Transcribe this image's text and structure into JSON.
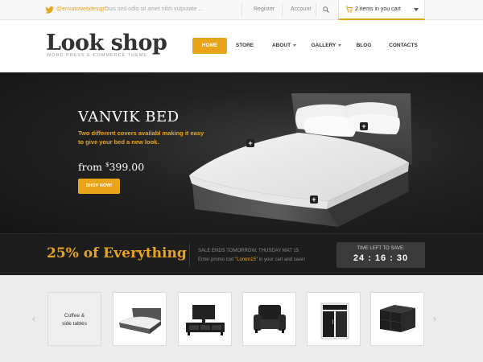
{
  "topbar": {
    "twitter_handle": "@envatowebdesign:",
    "tweet": "Duis sed odio sit amet nibh vulputate ...",
    "register": "Register",
    "account": "Account",
    "cart_label": "2 items in you cart"
  },
  "header": {
    "logo_title": "Look shop",
    "logo_subtitle": "WORD PRESS E-COMMERCE THEME"
  },
  "nav": {
    "home": "HOME",
    "store": "STORE",
    "about": "ABOUT",
    "gallery": "GALLERY",
    "blog": "BLOG",
    "contacts": "CONTACTS"
  },
  "hero": {
    "title": "VANVIK BED",
    "description": "Two different covers availabl making it easy to give your bed a new look.",
    "price_prefix": "from",
    "price_currency": "$",
    "price_value": "399.00",
    "button": "SHOP NOW!"
  },
  "promo": {
    "headline": "25% of Everything",
    "line1": "SALE ENDS TOMORROW, THUSDAY MAT 15",
    "line2_before": "Enter promo cod ",
    "line2_code": "\"Lorem15\"",
    "line2_after": " in your cart and save!",
    "timer_label": "TIME LEFT TO SAVE:",
    "timer_value": "24 : 16 : 30"
  },
  "carousel": {
    "coffee_line1": "Coffee &",
    "coffee_line2": "side tables",
    "prev_arrow": "‹",
    "next_arrow": "›"
  },
  "colors": {
    "accent": "#e8a41b",
    "hero_bg": "#1f1f1f",
    "text_dark": "#333333"
  }
}
